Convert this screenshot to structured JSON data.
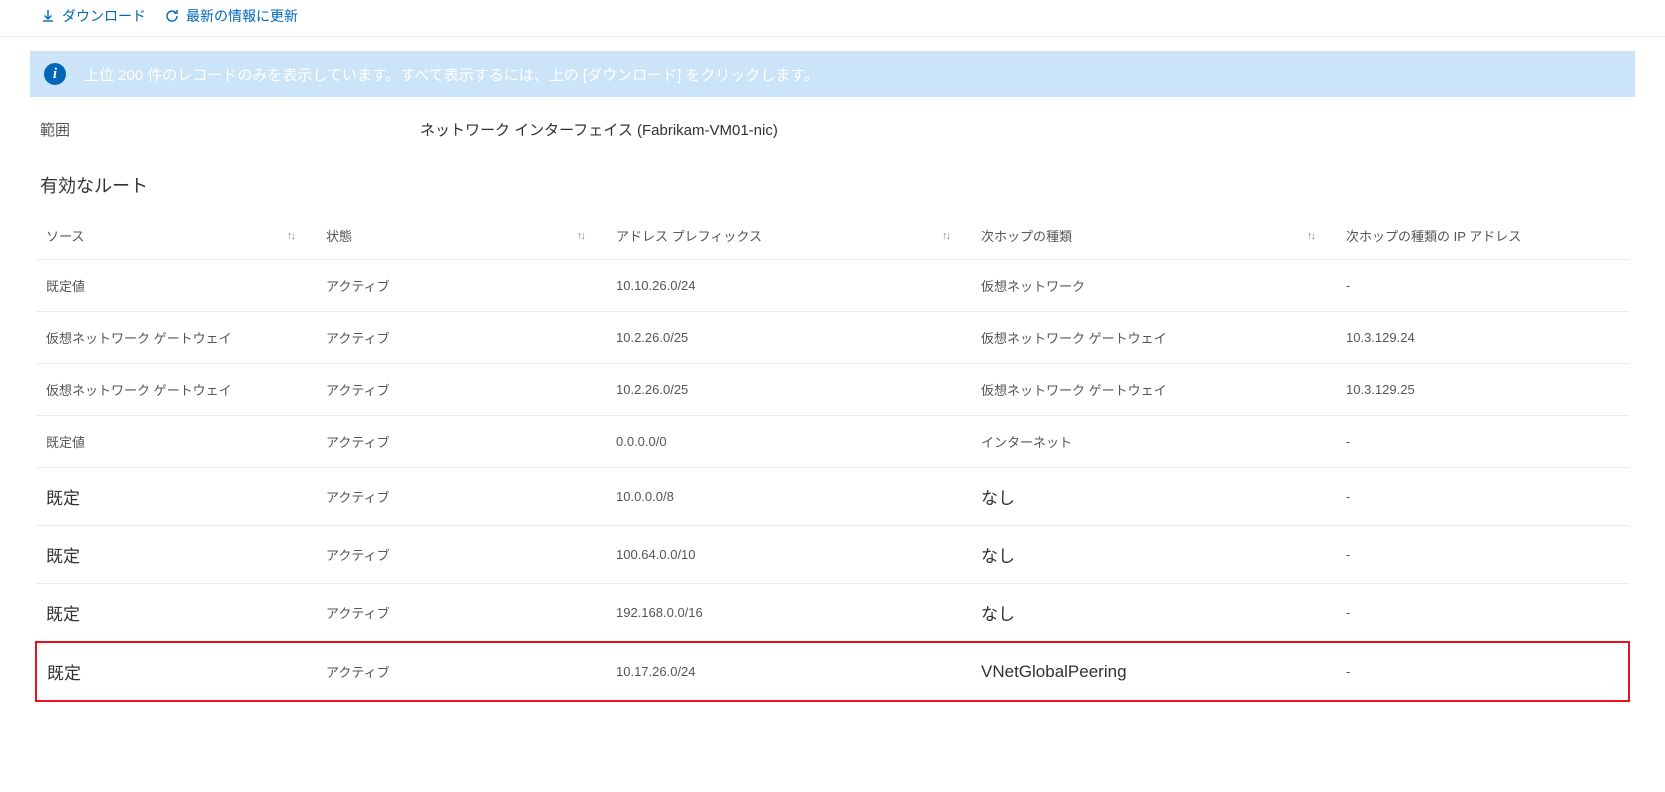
{
  "toolbar": {
    "download_label": "ダウンロード",
    "refresh_label": "最新の情報に更新"
  },
  "banner": {
    "text": "上位 200 件のレコードのみを表示しています。すべて表示するには、上の [ダウンロード] をクリックします。"
  },
  "scope": {
    "label": "範囲",
    "value": "ネットワーク インターフェイス (Fabrikam-VM01-nic)"
  },
  "section_title": "有効なルート",
  "columns": {
    "source": "ソース",
    "state": "状態",
    "prefix": "アドレス プレフィックス",
    "next_hop_type": "次ホップの種類",
    "next_hop_ip": "次ホップの種類の IP アドレス"
  },
  "rows": [
    {
      "source": "既定値",
      "state": "アクティブ",
      "prefix": "10.10.26.0/24",
      "next_hop_type": "仮想ネットワーク",
      "next_hop_ip": "-",
      "big": false,
      "highlight": false
    },
    {
      "source": "仮想ネットワーク ゲートウェイ",
      "state": "アクティブ",
      "prefix": "10.2.26.0/25",
      "next_hop_type": "仮想ネットワーク ゲートウェイ",
      "next_hop_ip": "10.3.129.24",
      "big": false,
      "highlight": false
    },
    {
      "source": "仮想ネットワーク ゲートウェイ",
      "state": "アクティブ",
      "prefix": "10.2.26.0/25",
      "next_hop_type": "仮想ネットワーク ゲートウェイ",
      "next_hop_ip": "10.3.129.25",
      "big": false,
      "highlight": false
    },
    {
      "source": "既定値",
      "state": "アクティブ",
      "prefix": "0.0.0.0/0",
      "next_hop_type": "インターネット",
      "next_hop_ip": "-",
      "big": false,
      "highlight": false
    },
    {
      "source": "既定",
      "state": "アクティブ",
      "prefix": "10.0.0.0/8",
      "next_hop_type": "なし",
      "next_hop_ip": "-",
      "big": true,
      "highlight": false
    },
    {
      "source": "既定",
      "state": "アクティブ",
      "prefix": "100.64.0.0/10",
      "next_hop_type": "なし",
      "next_hop_ip": "-",
      "big": true,
      "highlight": false
    },
    {
      "source": "既定",
      "state": "アクティブ",
      "prefix": "192.168.0.0/16",
      "next_hop_type": "なし",
      "next_hop_ip": "-",
      "big": true,
      "highlight": false
    },
    {
      "source": "既定",
      "state": "アクティブ",
      "prefix": "10.17.26.0/24",
      "next_hop_type": "VNetGlobalPeering",
      "next_hop_ip": "-",
      "big": true,
      "highlight": true
    }
  ]
}
